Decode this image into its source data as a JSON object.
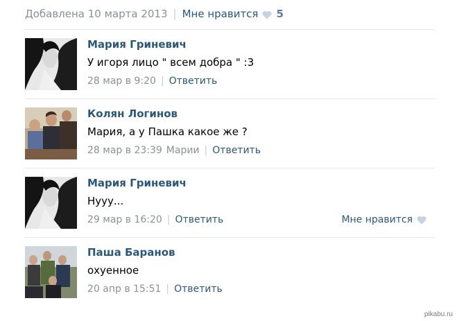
{
  "post": {
    "added_date": "Добавлена 10 марта 2013",
    "like_label": "Мне нравится",
    "like_count": "5",
    "like_icon": "heart-icon"
  },
  "comments": [
    {
      "author": "Мария Гриневич",
      "text": "У игоря лицо \" всем добра \" :3",
      "time": "28 мар в 9:20",
      "reply_label": "Ответить"
    },
    {
      "author": "Колян Логинов",
      "text": "Мария, а у Пашка какое же ?",
      "time": "28 мар в 23:39",
      "reply_to": "Марии",
      "reply_label": "Ответить"
    },
    {
      "author": "Мария Гриневич",
      "text": "Нууу...",
      "time": "29 мар в 16:20",
      "reply_label": "Ответить",
      "like_label": "Мне нравится"
    },
    {
      "author": "Паша Баранов",
      "text": "охуенное",
      "time": "20 апр в 15:51",
      "reply_label": "Ответить"
    }
  ],
  "watermark": "pikabu.ru",
  "colors": {
    "link": "#2b587a",
    "meta": "#8a8f98",
    "heart": "#c3d3e3",
    "divider": "#e4e8ee"
  }
}
